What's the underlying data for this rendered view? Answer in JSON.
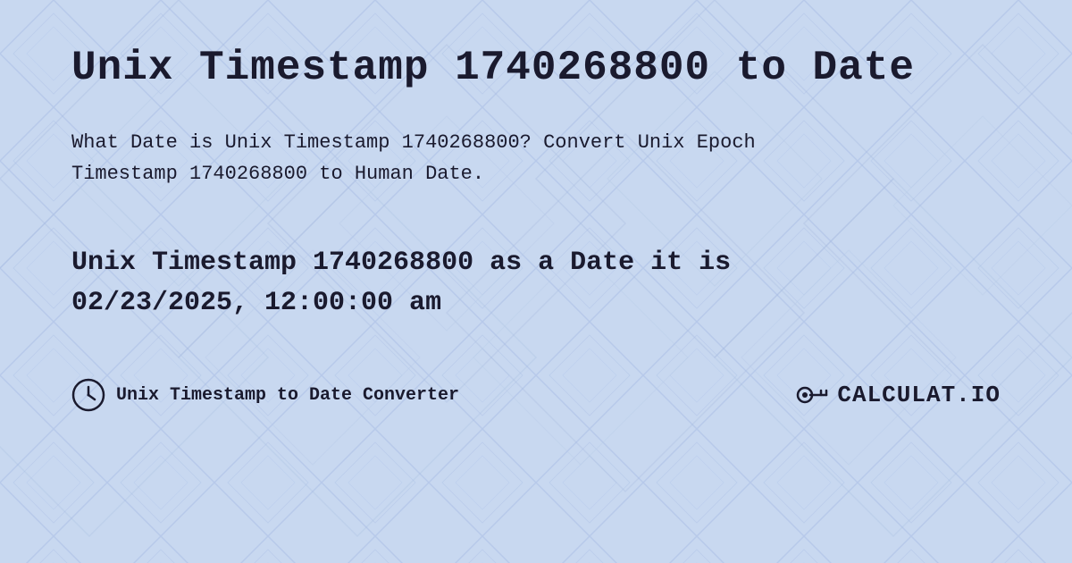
{
  "page": {
    "title": "Unix Timestamp 1740268800 to Date",
    "description_part1": "What Date is Unix Timestamp 1740268800? Convert Unix Epoch",
    "description_part2": "Timestamp 1740268800 to Human Date.",
    "result_line1": "Unix Timestamp 1740268800 as a Date it is",
    "result_line2": "02/23/2025, 12:00:00 am",
    "footer_label": "Unix Timestamp to Date Converter",
    "logo_text": "CALCULAT.IO",
    "background_color": "#c8d8f0",
    "text_color": "#1a1a2e"
  }
}
